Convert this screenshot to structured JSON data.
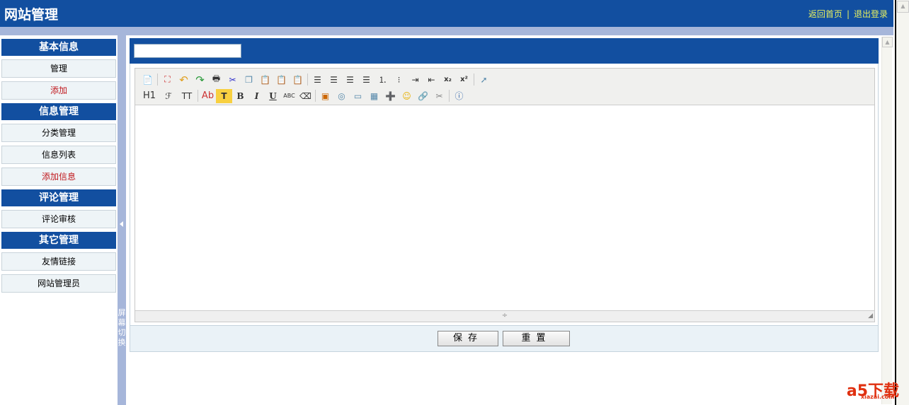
{
  "header": {
    "title": "网站管理",
    "links": [
      "返回首页",
      "退出登录"
    ],
    "separator": "|"
  },
  "sidebar": {
    "sections": [
      {
        "title": "基本信息",
        "items": [
          {
            "label": "管理"
          },
          {
            "label": "添加"
          }
        ]
      },
      {
        "title": "信息管理",
        "items": [
          {
            "label": "分类管理"
          },
          {
            "label": "信息列表"
          },
          {
            "label": "添加信息"
          }
        ]
      },
      {
        "title": "评论管理",
        "items": [
          {
            "label": "评论审核"
          }
        ]
      },
      {
        "title": "其它管理",
        "items": [
          {
            "label": "友情链接"
          },
          {
            "label": "网站管理员"
          }
        ]
      }
    ]
  },
  "splitter": {
    "label": "屏幕切换"
  },
  "form": {
    "title_value": ""
  },
  "toolbar": {
    "heading": "H1",
    "font": "ℱ",
    "size": "TT",
    "forecolor": "Ab",
    "backcolor": "T",
    "bold": "B",
    "italic": "I",
    "underline": "U",
    "strike": "ABC",
    "subscript": "x₂",
    "superscript": "x²"
  },
  "actions": {
    "save": "保存",
    "reset": "重置"
  },
  "watermark": {
    "brand": "a5下载",
    "domain": "xiazai.com"
  },
  "colors": {
    "header": "#124fa0",
    "accent_link": "#e8f060",
    "red_item": "#c0171c"
  }
}
